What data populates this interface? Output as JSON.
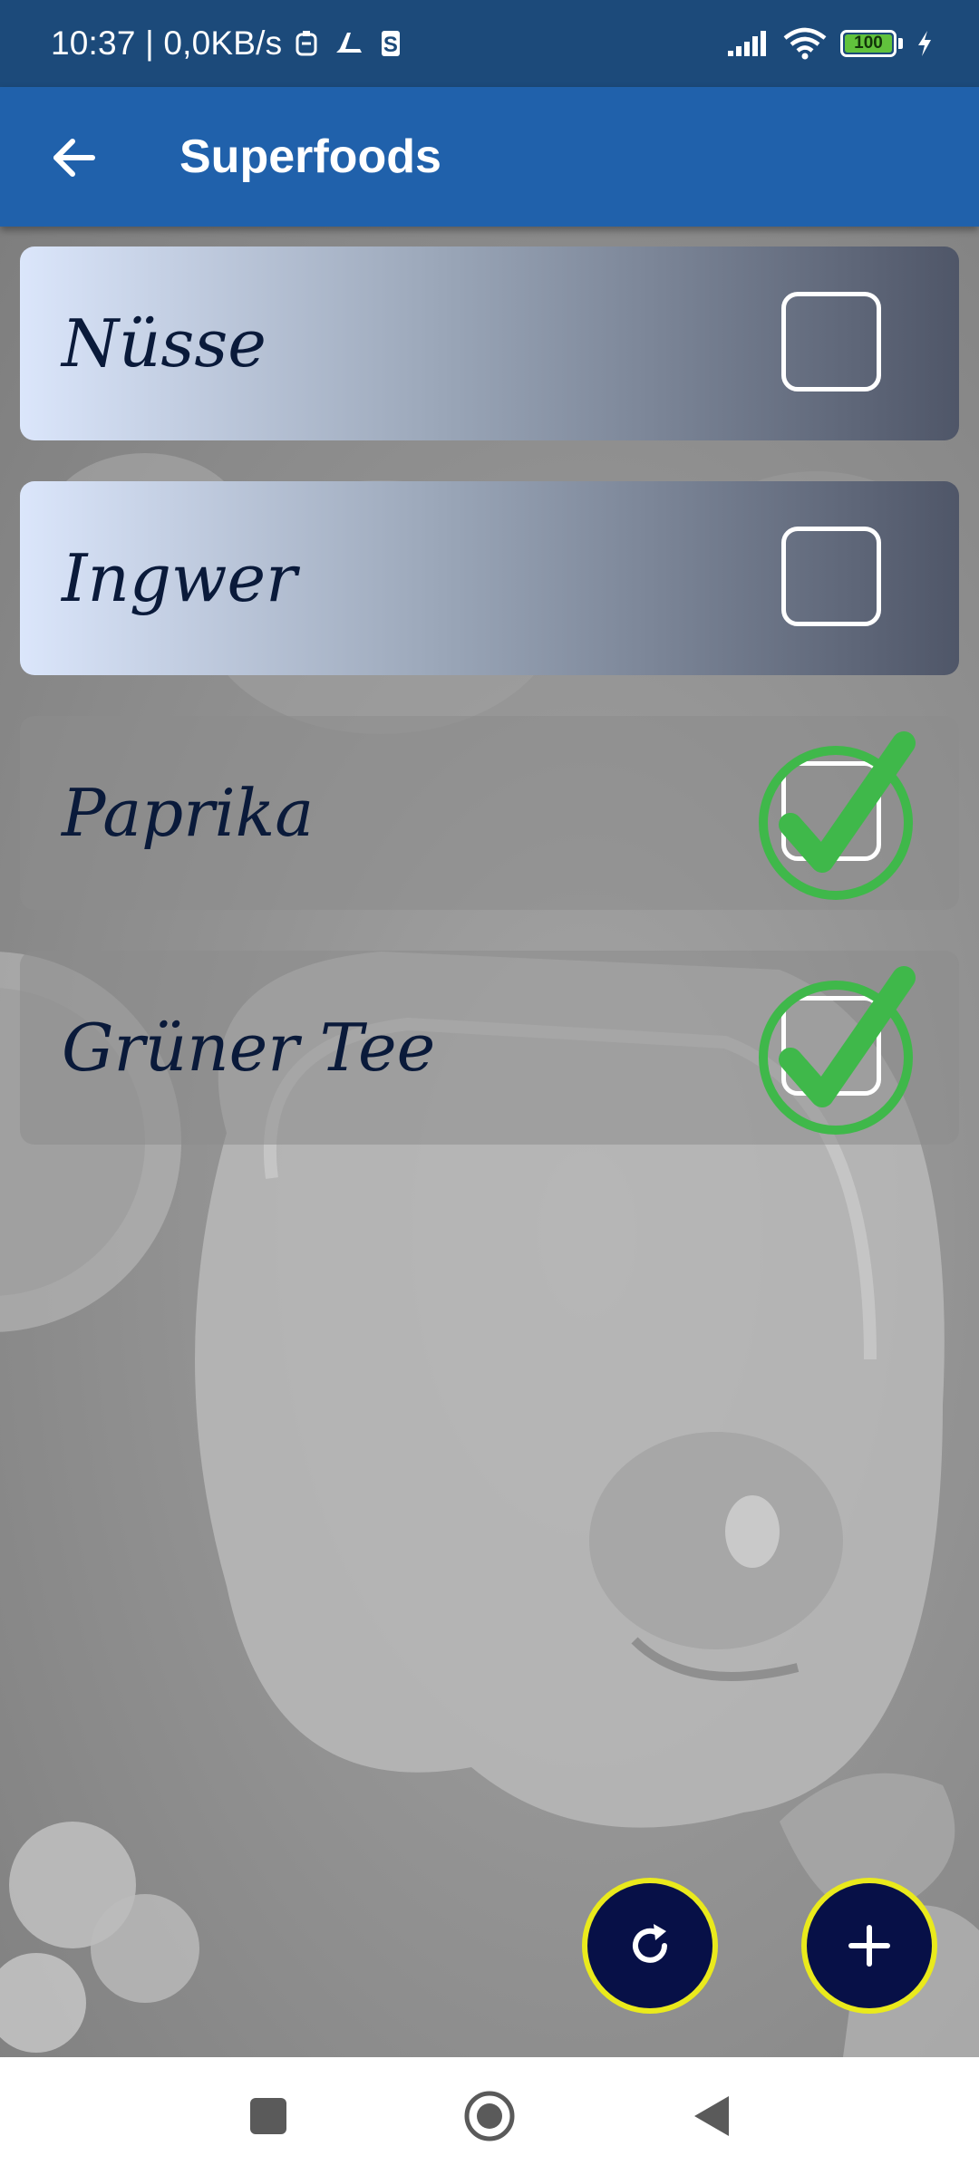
{
  "status_bar": {
    "time_speed": "10:37 | 0,0KB/s",
    "battery": "100",
    "icons": [
      "sim-icon",
      "app-notification-icon",
      "s-app-icon",
      "signal-icon",
      "wifi-icon",
      "battery-icon",
      "charging-icon"
    ]
  },
  "app_bar": {
    "title": "Superfoods",
    "back_icon": "arrow-left-icon"
  },
  "items": [
    {
      "label": "Nüsse",
      "checked": false
    },
    {
      "label": "Ingwer",
      "checked": false
    },
    {
      "label": "Paprika",
      "checked": true
    },
    {
      "label": "Grüner Tee",
      "checked": true
    }
  ],
  "fabs": {
    "refresh_icon": "refresh-icon",
    "add_icon": "plus-icon"
  },
  "nav_bar": {
    "icons": [
      "recents-square-icon",
      "home-circle-icon",
      "back-triangle-icon"
    ]
  },
  "colors": {
    "status_bar": "#1c4a7a",
    "app_bar": "#2061ab",
    "fab_fill": "#071047",
    "fab_border": "#eaea1c",
    "check_green": "#3fb84a"
  }
}
